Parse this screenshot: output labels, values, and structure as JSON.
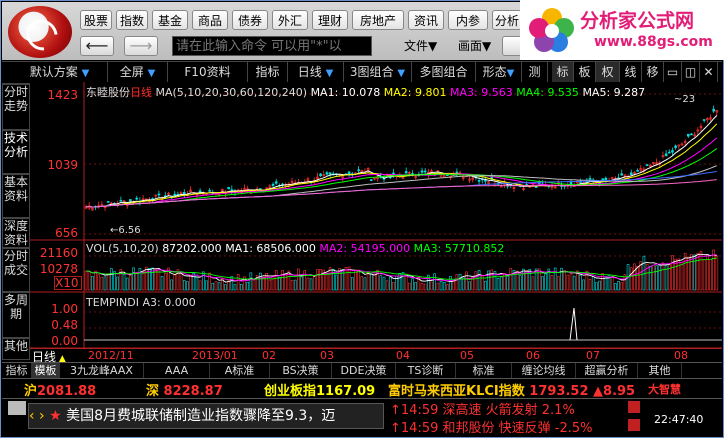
{
  "menu": [
    "股票",
    "指数",
    "基金",
    "商品",
    "债券",
    "外汇",
    "理财",
    "房地产",
    "资讯",
    "内参",
    "分析"
  ],
  "command_placeholder": "请在此输入命令  可以用\"*\"以",
  "dropdowns": [
    "文件▼",
    "画面▼"
  ],
  "brand": {
    "title": "分析家公式网",
    "url": "www.88gs.com"
  },
  "toolbar": [
    "默认方案",
    "全屏",
    "F10资料",
    "指标",
    "日线",
    "3图组合",
    "多图组合",
    "形态",
    "测",
    "标",
    "板",
    "权",
    "线",
    "移"
  ],
  "side_tabs": [
    "分时走势",
    "技术分析",
    "基本资料",
    "深度资料",
    "分时成交",
    "多周期",
    "其他"
  ],
  "chart_data": {
    "type": "line",
    "title": "东睦股份",
    "period_label": "日线",
    "ma_legend": "MA(5,10,20,30,60,120,240)",
    "ma_values": [
      {
        "name": "MA1",
        "value": "10.078",
        "color": "#ffffff"
      },
      {
        "name": "MA2",
        "value": "9.801",
        "color": "#ffff00"
      },
      {
        "name": "MA3",
        "value": "9.563",
        "color": "#ff00ff"
      },
      {
        "name": "MA4",
        "value": "9.535",
        "color": "#00ff00"
      },
      {
        "name": "MA5",
        "value": "9.287",
        "color": "#ffffff"
      }
    ],
    "price_ticks": [
      "1423",
      "1039",
      "656"
    ],
    "price_low_label": "6.56",
    "price_high_label": "~23",
    "volume_legend": {
      "label": "VOL(5,10,20)",
      "value": "87202.000",
      "ma1": "68506.000",
      "ma2": "54195.000",
      "ma3": "57710.852"
    },
    "volume_ticks": [
      "21160",
      "10278",
      "X10"
    ],
    "indicator_legend": {
      "label": "TEMPINDI",
      "a3": "0.000"
    },
    "indicator_ticks": [
      "1.00",
      "0.48",
      "0.00"
    ],
    "x_labels": [
      "2012/11",
      "2013/01",
      "02",
      "03",
      "04",
      "05",
      "06",
      "07",
      "08"
    ]
  },
  "period": "日线",
  "bottom_tabs": [
    "指标",
    "模板",
    "3九龙峰AAX",
    "AAA",
    "A标准",
    "BS决策",
    "DDE决策",
    "TS诊断",
    "标准",
    "缠论均线",
    "超赢分析",
    "其他"
  ],
  "quotes": [
    {
      "label": "沪",
      "value": "2081.88",
      "color": "#ff3030"
    },
    {
      "label": "深",
      "value": "8228.87",
      "color": "#ff3030"
    },
    {
      "label": "创业板指",
      "value": "1167.09",
      "color": "#ffff00"
    },
    {
      "label": "富时马来西亚KLCI指数",
      "value": "1793.52",
      "change": "▲8.95",
      "color": "#ff3030"
    }
  ],
  "news": {
    "text": "美国8月费城联储制造业指数骤降至9.3，迈"
  },
  "alerts": [
    {
      "time": "14:59",
      "text": "深高速  火箭发射 2.1%"
    },
    {
      "time": "14:59",
      "text": "和邦股份 快速反弹 -2.5%"
    }
  ],
  "clock": "22:47:40",
  "logo_small": "大智慧"
}
